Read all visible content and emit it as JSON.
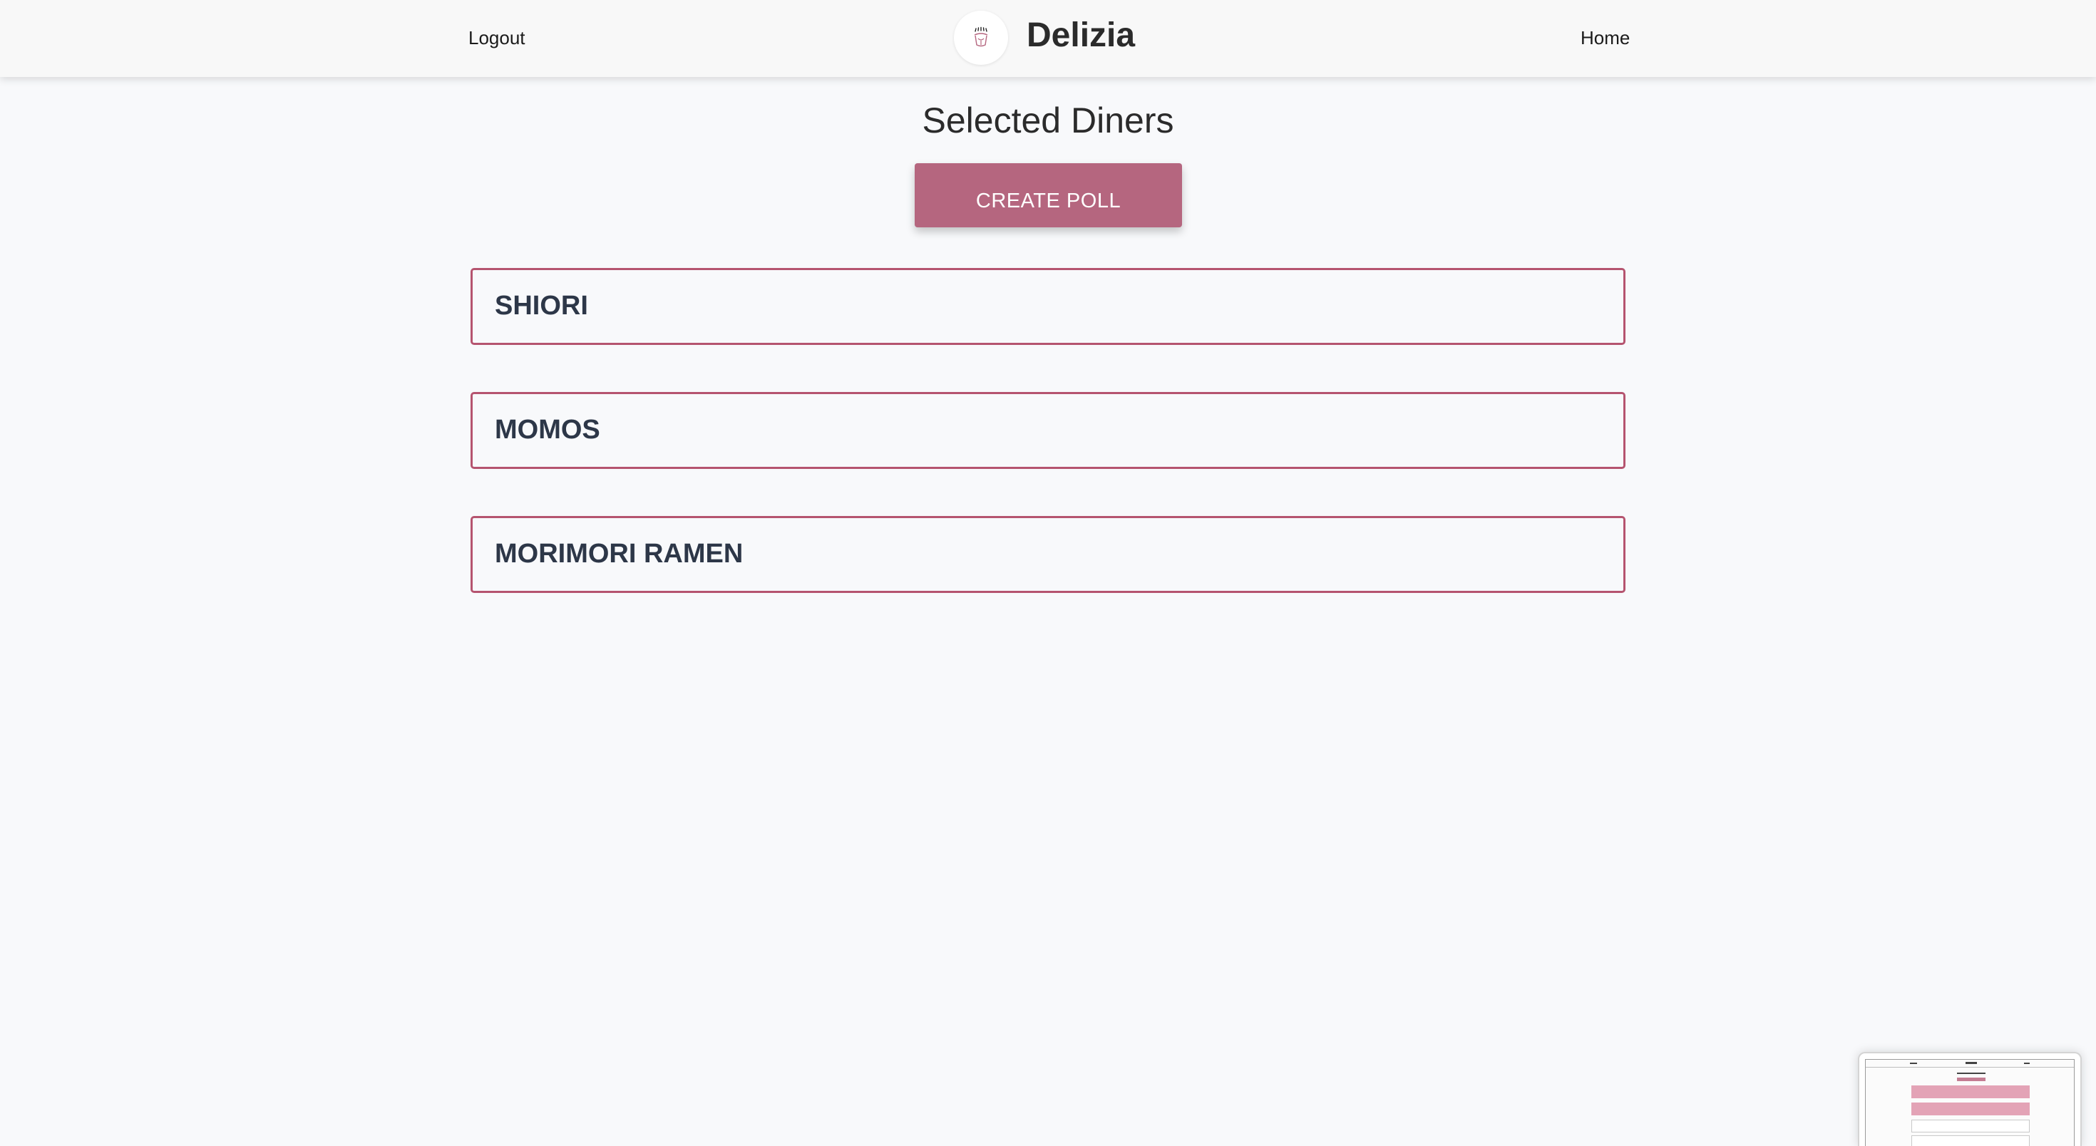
{
  "header": {
    "logout_label": "Logout",
    "brand_name": "Delizia",
    "home_label": "Home",
    "logo_icon": "chef-icon"
  },
  "main": {
    "title": "Selected Diners",
    "create_poll_label": "CREATE POLL",
    "diners": [
      {
        "name": "SHIORI"
      },
      {
        "name": "MOMOS"
      },
      {
        "name": "MORIMORI RAMEN"
      }
    ]
  },
  "colors": {
    "accent": "#b5667f",
    "card_border": "#b5546f",
    "background": "#f8f9fb"
  }
}
